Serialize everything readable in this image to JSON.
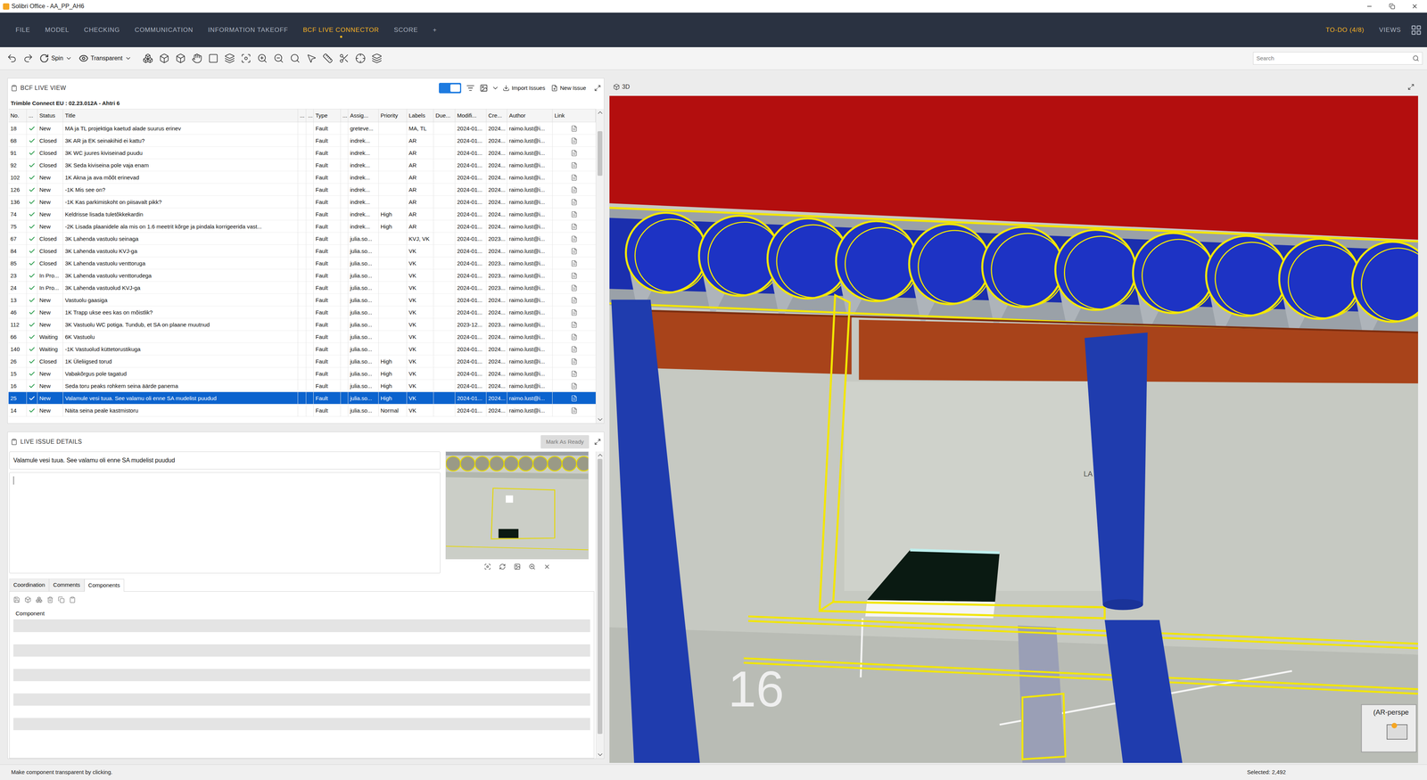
{
  "window": {
    "title": "Solibri Office - AA_PP_AH6"
  },
  "menu": {
    "tabs": [
      {
        "label": "FILE",
        "selected": false
      },
      {
        "label": "MODEL",
        "selected": false
      },
      {
        "label": "CHECKING",
        "selected": false
      },
      {
        "label": "COMMUNICATION",
        "selected": false
      },
      {
        "label": "INFORMATION TAKEOFF",
        "selected": false
      },
      {
        "label": "BCF LIVE CONNECTOR",
        "selected": true
      },
      {
        "label": "SCORE",
        "selected": false
      },
      {
        "label": "+",
        "selected": false
      }
    ],
    "todo": "TO-DO (4/8)",
    "views": "VIEWS"
  },
  "toolbar": {
    "spin": "Spin",
    "transparent": "Transparent",
    "search": {
      "placeholder": "Search"
    }
  },
  "bcf": {
    "title": "BCF LIVE VIEW",
    "live": {
      "on": true
    },
    "import_issues": "Import Issues",
    "new_issue": "New Issue",
    "project": "Trimble Connect EU : 02.23.012A - Ahtri 6",
    "columns": [
      "No.",
      "...",
      "Status",
      "Title",
      "...",
      "...",
      "Type",
      "...",
      "Assig...",
      "Priority",
      "Labels",
      "Due...",
      "Modifi...",
      "Cre...",
      "Author",
      "Link"
    ],
    "rows": [
      {
        "no": "18",
        "status": "New",
        "title": "MA ja TL projektiga kaetud alade suurus erinev",
        "type": "Fault",
        "assignee": "greteve...",
        "priority": "",
        "labels": "MA, TL",
        "due": "",
        "modified": "2024-01...",
        "created": "2024...",
        "author": "raimo.lust@i...",
        "selected": false
      },
      {
        "no": "68",
        "status": "Closed",
        "title": "3K AR ja EK seinakihid ei kattu?",
        "type": "Fault",
        "assignee": "indrek...",
        "priority": "",
        "labels": "AR",
        "due": "",
        "modified": "2024-01...",
        "created": "2024...",
        "author": "raimo.lust@i...",
        "selected": false
      },
      {
        "no": "91",
        "status": "Closed",
        "title": "3K WC juures kiviseinad puudu",
        "type": "Fault",
        "assignee": "indrek...",
        "priority": "",
        "labels": "AR",
        "due": "",
        "modified": "2024-01...",
        "created": "2024...",
        "author": "raimo.lust@i...",
        "selected": false
      },
      {
        "no": "92",
        "status": "Closed",
        "title": "3K Seda kiviseina pole vaja enam",
        "type": "Fault",
        "assignee": "indrek...",
        "priority": "",
        "labels": "AR",
        "due": "",
        "modified": "2024-01...",
        "created": "2024...",
        "author": "raimo.lust@i...",
        "selected": false
      },
      {
        "no": "102",
        "status": "New",
        "title": "1K Akna ja ava mõõt erinevad",
        "type": "Fault",
        "assignee": "indrek...",
        "priority": "",
        "labels": "AR",
        "due": "",
        "modified": "2024-01...",
        "created": "2024...",
        "author": "raimo.lust@i...",
        "selected": false
      },
      {
        "no": "126",
        "status": "New",
        "title": "-1K Mis see on?",
        "type": "Fault",
        "assignee": "indrek...",
        "priority": "",
        "labels": "AR",
        "due": "",
        "modified": "2024-01...",
        "created": "2024...",
        "author": "raimo.lust@i...",
        "selected": false
      },
      {
        "no": "136",
        "status": "New",
        "title": "-1K Kas parkimiskoht on piisavalt pikk?",
        "type": "Fault",
        "assignee": "indrek...",
        "priority": "",
        "labels": "AR",
        "due": "",
        "modified": "2024-01...",
        "created": "2024...",
        "author": "raimo.lust@i...",
        "selected": false
      },
      {
        "no": "74",
        "status": "New",
        "title": "Keldrisse lisada tuletõkkekardin",
        "type": "Fault",
        "assignee": "indrek...",
        "priority": "High",
        "labels": "AR",
        "due": "",
        "modified": "2024-01...",
        "created": "2024...",
        "author": "raimo.lust@i...",
        "selected": false
      },
      {
        "no": "75",
        "status": "New",
        "title": "-2K Lisada plaanidele ala mis on 1.6 meetrit kõrge ja pindala korrigeerida vast...",
        "type": "Fault",
        "assignee": "indrek...",
        "priority": "High",
        "labels": "AR",
        "due": "",
        "modified": "2024-01...",
        "created": "2024...",
        "author": "raimo.lust@i...",
        "selected": false
      },
      {
        "no": "67",
        "status": "Closed",
        "title": "3K Lahenda vastuolu seinaga",
        "type": "Fault",
        "assignee": "julia.so...",
        "priority": "",
        "labels": "KVJ, VK",
        "due": "",
        "modified": "2024-01...",
        "created": "2023...",
        "author": "raimo.lust@i...",
        "selected": false
      },
      {
        "no": "84",
        "status": "Closed",
        "title": "3K Lahenda vastuolu KVJ-ga",
        "type": "Fault",
        "assignee": "julia.so...",
        "priority": "",
        "labels": "VK",
        "due": "",
        "modified": "2024-01...",
        "created": "2024...",
        "author": "raimo.lust@i...",
        "selected": false
      },
      {
        "no": "85",
        "status": "Closed",
        "title": "3K Lahenda vastuolu venttoruga",
        "type": "Fault",
        "assignee": "julia.so...",
        "priority": "",
        "labels": "VK",
        "due": "",
        "modified": "2024-01...",
        "created": "2023...",
        "author": "raimo.lust@i...",
        "selected": false
      },
      {
        "no": "23",
        "status": "In Pro...",
        "title": "3K Lahenda vastuolu venttorudega",
        "type": "Fault",
        "assignee": "julia.so...",
        "priority": "",
        "labels": "VK",
        "due": "",
        "modified": "2024-01...",
        "created": "2023...",
        "author": "raimo.lust@i...",
        "selected": false
      },
      {
        "no": "24",
        "status": "In Pro...",
        "title": "3K Lahenda vastuolud KVJ-ga",
        "type": "Fault",
        "assignee": "julia.so...",
        "priority": "",
        "labels": "VK",
        "due": "",
        "modified": "2024-01...",
        "created": "2023...",
        "author": "raimo.lust@i...",
        "selected": false
      },
      {
        "no": "13",
        "status": "New",
        "title": "Vastuolu gaasiga",
        "type": "Fault",
        "assignee": "julia.so...",
        "priority": "",
        "labels": "VK",
        "due": "",
        "modified": "2024-01...",
        "created": "2024...",
        "author": "raimo.lust@i...",
        "selected": false
      },
      {
        "no": "46",
        "status": "New",
        "title": "1K Trapp ukse ees kas on mõistlik?",
        "type": "Fault",
        "assignee": "julia.so...",
        "priority": "",
        "labels": "VK",
        "due": "",
        "modified": "2024-01...",
        "created": "2024...",
        "author": "raimo.lust@i...",
        "selected": false
      },
      {
        "no": "112",
        "status": "New",
        "title": "3K Vastuolu WC potiga. Tundub, et SA on plaane muutnud",
        "type": "Fault",
        "assignee": "julia.so...",
        "priority": "",
        "labels": "VK",
        "due": "",
        "modified": "2023-12...",
        "created": "2023...",
        "author": "raimo.lust@i...",
        "selected": false
      },
      {
        "no": "66",
        "status": "Waiting",
        "title": "6K Vastuolu",
        "type": "Fault",
        "assignee": "julia.so...",
        "priority": "",
        "labels": "VK",
        "due": "",
        "modified": "2024-01...",
        "created": "2024...",
        "author": "raimo.lust@i...",
        "selected": false
      },
      {
        "no": "140",
        "status": "Waiting",
        "title": "-1K Vastuolud küttetorustikuga",
        "type": "Fault",
        "assignee": "julia.so...",
        "priority": "",
        "labels": "VK",
        "due": "",
        "modified": "2024-01...",
        "created": "2024...",
        "author": "raimo.lust@i...",
        "selected": false
      },
      {
        "no": "26",
        "status": "Closed",
        "title": "1K Üleliigsed torud",
        "type": "Fault",
        "assignee": "julia.so...",
        "priority": "High",
        "labels": "VK",
        "due": "",
        "modified": "2024-01...",
        "created": "2024...",
        "author": "raimo.lust@i...",
        "selected": false
      },
      {
        "no": "15",
        "status": "New",
        "title": "Vabakõrgus pole tagatud",
        "type": "Fault",
        "assignee": "julia.so...",
        "priority": "High",
        "labels": "VK",
        "due": "",
        "modified": "2024-01...",
        "created": "2024...",
        "author": "raimo.lust@i...",
        "selected": false
      },
      {
        "no": "16",
        "status": "New",
        "title": "Seda toru peaks rohkem seina äärde panema",
        "type": "Fault",
        "assignee": "julia.so...",
        "priority": "High",
        "labels": "VK",
        "due": "",
        "modified": "2024-01...",
        "created": "2024...",
        "author": "raimo.lust@i...",
        "selected": false
      },
      {
        "no": "25",
        "status": "New",
        "title": "Valamule vesi tuua. See valamu oli enne SA mudelist puudud",
        "type": "Fault",
        "assignee": "julia.so...",
        "priority": "High",
        "labels": "VK",
        "due": "",
        "modified": "2024-01...",
        "created": "2024...",
        "author": "raimo.lust@i...",
        "selected": true
      },
      {
        "no": "14",
        "status": "New",
        "title": "Näita seina peale kastmistoru",
        "type": "Fault",
        "assignee": "julia.so...",
        "priority": "Normal",
        "labels": "VK",
        "due": "",
        "modified": "2024-01...",
        "created": "2024...",
        "author": "raimo.lust@i...",
        "selected": false
      }
    ]
  },
  "details": {
    "title": "LIVE ISSUE DETAILS",
    "mark_as_ready": {
      "label": "Mark As Ready",
      "disabled": true
    },
    "issue_title": "Valamule vesi tuua. See valamu oli enne SA mudelist puudud",
    "description": "",
    "tabs": [
      {
        "label": "Coordination",
        "selected": false
      },
      {
        "label": "Comments",
        "selected": false
      },
      {
        "label": "Components",
        "selected": true
      }
    ],
    "components": {
      "column": "Component",
      "rows": []
    }
  },
  "viewport": {
    "title": "3D",
    "labels": [
      "16",
      "LA"
    ],
    "view_cube_label": "(AR-perspe"
  },
  "status_bar": {
    "hint": "Make component transparent by clicking.",
    "selected": "Selected: 2,492"
  }
}
